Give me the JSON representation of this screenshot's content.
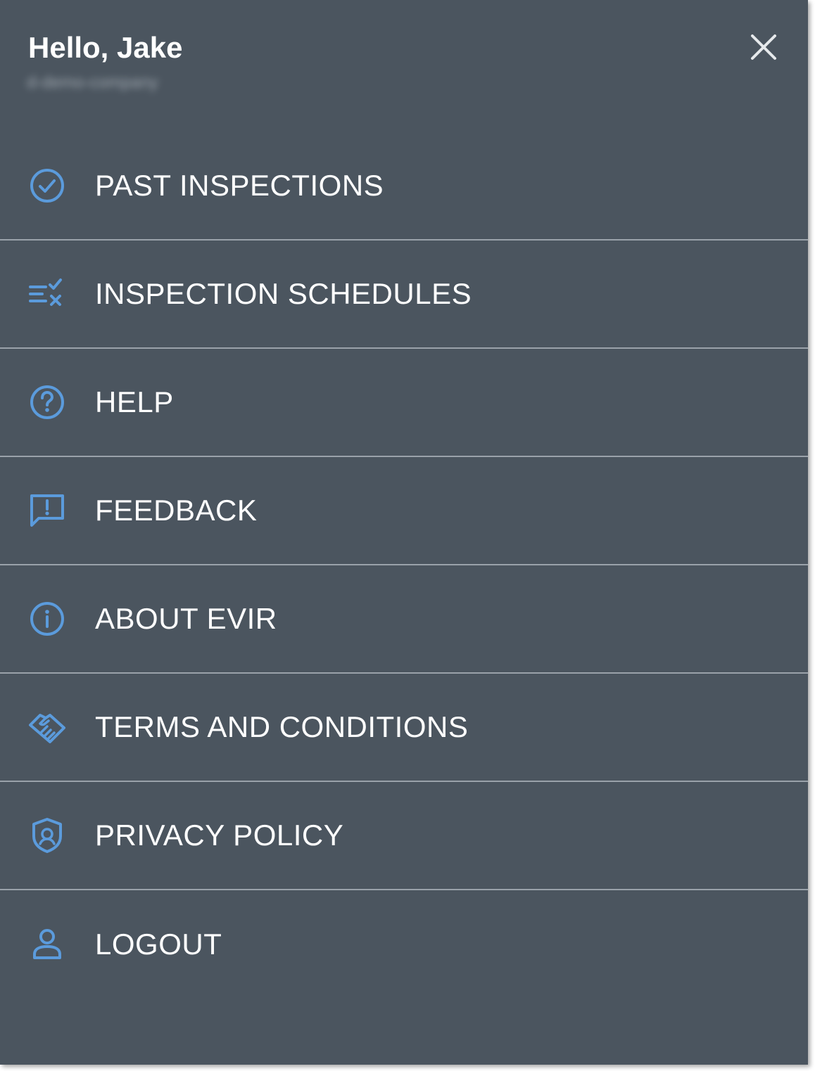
{
  "header": {
    "greeting": "Hello, Jake",
    "company": "d-demo-company"
  },
  "menu": {
    "items": [
      {
        "label": "PAST INSPECTIONS",
        "icon": "check-circle-icon"
      },
      {
        "label": "INSPECTION SCHEDULES",
        "icon": "schedule-checklist-icon"
      },
      {
        "label": "HELP",
        "icon": "question-circle-icon"
      },
      {
        "label": "FEEDBACK",
        "icon": "feedback-message-icon"
      },
      {
        "label": "ABOUT EVIR",
        "icon": "info-circle-icon"
      },
      {
        "label": "TERMS AND CONDITIONS",
        "icon": "handshake-icon"
      },
      {
        "label": "PRIVACY POLICY",
        "icon": "shield-icon"
      },
      {
        "label": "LOGOUT",
        "icon": "user-icon"
      }
    ]
  },
  "colors": {
    "background": "#4b555f",
    "accent": "#5b9bdc",
    "divider": "#9aa2aa",
    "text": "#ffffff"
  }
}
